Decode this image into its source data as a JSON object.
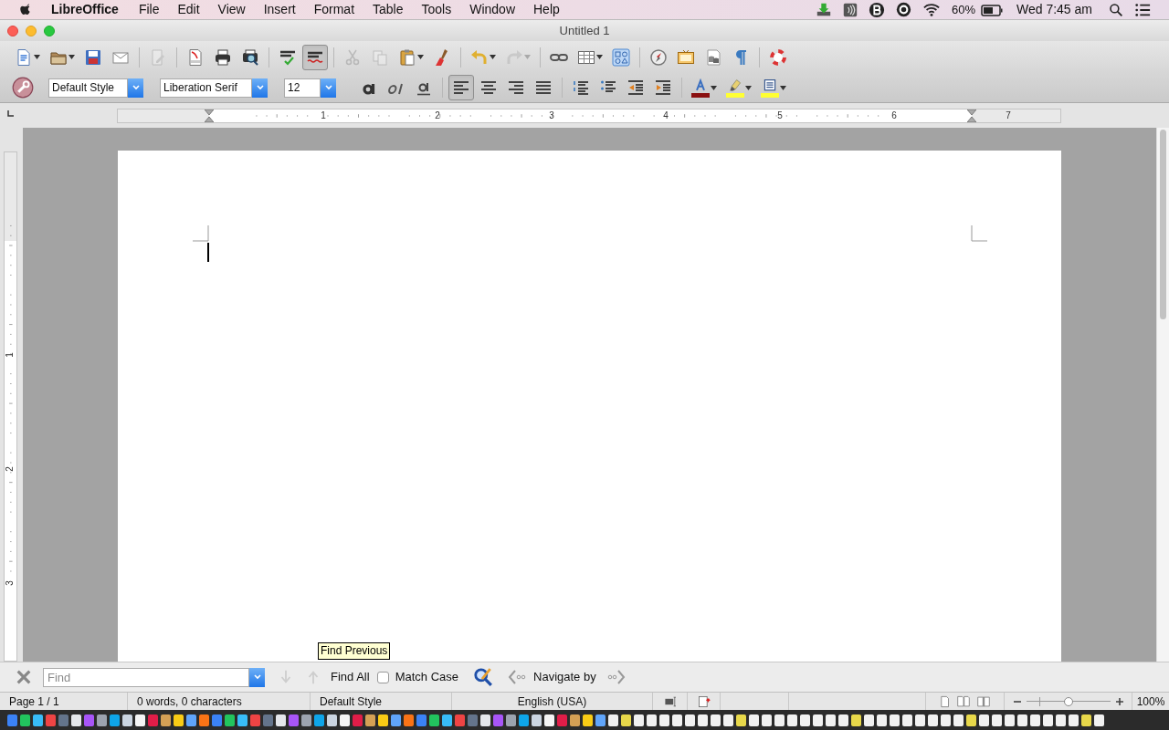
{
  "menu_bar": {
    "app_name": "LibreOffice",
    "menus": [
      "File",
      "Edit",
      "View",
      "Insert",
      "Format",
      "Table",
      "Tools",
      "Window",
      "Help"
    ],
    "battery": "60%",
    "clock": "Wed 7:45 am"
  },
  "window": {
    "title": "Untitled 1"
  },
  "standard_toolbar": [
    {
      "kind": "new",
      "dropdown": true,
      "disabled": false,
      "selected": false
    },
    {
      "kind": "open",
      "dropdown": true,
      "disabled": false,
      "selected": false
    },
    {
      "kind": "save",
      "dropdown": false,
      "disabled": false,
      "selected": false
    },
    {
      "kind": "email",
      "dropdown": false,
      "disabled": false,
      "selected": false
    },
    {
      "kind": "separator"
    },
    {
      "kind": "edit",
      "dropdown": false,
      "disabled": true,
      "selected": false
    },
    {
      "kind": "separator"
    },
    {
      "kind": "pdf",
      "dropdown": false,
      "disabled": false,
      "selected": false
    },
    {
      "kind": "print",
      "dropdown": false,
      "disabled": false,
      "selected": false
    },
    {
      "kind": "preview",
      "dropdown": false,
      "disabled": false,
      "selected": false
    },
    {
      "kind": "separator"
    },
    {
      "kind": "spell",
      "dropdown": false,
      "disabled": false,
      "selected": false
    },
    {
      "kind": "autospell",
      "dropdown": false,
      "disabled": false,
      "selected": true
    },
    {
      "kind": "separator"
    },
    {
      "kind": "cut",
      "dropdown": false,
      "disabled": true,
      "selected": false
    },
    {
      "kind": "copy",
      "dropdown": false,
      "disabled": true,
      "selected": false
    },
    {
      "kind": "paste",
      "dropdown": true,
      "disabled": false,
      "selected": false
    },
    {
      "kind": "clone",
      "dropdown": false,
      "disabled": false,
      "selected": false
    },
    {
      "kind": "separator"
    },
    {
      "kind": "undo",
      "dropdown": true,
      "disabled": false,
      "selected": false
    },
    {
      "kind": "redo",
      "dropdown": true,
      "disabled": true,
      "selected": false
    },
    {
      "kind": "separator"
    },
    {
      "kind": "hyperlink",
      "dropdown": false,
      "disabled": false,
      "selected": false
    },
    {
      "kind": "table",
      "dropdown": true,
      "disabled": false,
      "selected": false
    },
    {
      "kind": "draw",
      "dropdown": false,
      "disabled": false,
      "selected": false
    },
    {
      "kind": "separator"
    },
    {
      "kind": "navigator",
      "dropdown": false,
      "disabled": false,
      "selected": false
    },
    {
      "kind": "gallery",
      "dropdown": false,
      "disabled": false,
      "selected": false
    },
    {
      "kind": "datasource",
      "dropdown": false,
      "disabled": false,
      "selected": false
    },
    {
      "kind": "marks",
      "dropdown": false,
      "disabled": false,
      "selected": false
    },
    {
      "kind": "separator"
    },
    {
      "kind": "help",
      "dropdown": false,
      "disabled": false,
      "selected": false
    }
  ],
  "formatting_toolbar": {
    "paragraph_style": "Default Style",
    "font_name": "Liberation Serif",
    "font_size": "12",
    "buttons": [
      {
        "kind": "bold",
        "dropdown": false,
        "disabled": false,
        "selected": false
      },
      {
        "kind": "italic",
        "dropdown": false,
        "disabled": false,
        "selected": false
      },
      {
        "kind": "underline",
        "dropdown": false,
        "disabled": false,
        "selected": false
      },
      {
        "kind": "separator"
      },
      {
        "kind": "align_left",
        "dropdown": false,
        "disabled": false,
        "selected": true
      },
      {
        "kind": "align_center",
        "dropdown": false,
        "disabled": false,
        "selected": false
      },
      {
        "kind": "align_right",
        "dropdown": false,
        "disabled": false,
        "selected": false
      },
      {
        "kind": "justify",
        "dropdown": false,
        "disabled": false,
        "selected": false
      },
      {
        "kind": "separator"
      },
      {
        "kind": "numbering",
        "dropdown": false,
        "disabled": false,
        "selected": false
      },
      {
        "kind": "bullets",
        "dropdown": false,
        "disabled": false,
        "selected": false
      },
      {
        "kind": "indent_less",
        "dropdown": false,
        "disabled": false,
        "selected": false
      },
      {
        "kind": "indent_more",
        "dropdown": false,
        "disabled": false,
        "selected": false
      },
      {
        "kind": "separator"
      },
      {
        "kind": "font_color",
        "dropdown": true,
        "disabled": false,
        "selected": false,
        "color": "#8b1010"
      },
      {
        "kind": "highlight",
        "dropdown": true,
        "disabled": false,
        "selected": false,
        "color": "#ffff33"
      },
      {
        "kind": "background",
        "dropdown": true,
        "disabled": false,
        "selected": false,
        "color": "#ffff33"
      }
    ]
  },
  "horizontal_ruler": {
    "numbers": [
      "1",
      "2",
      "3",
      "4",
      "5",
      "6",
      "7"
    ]
  },
  "vertical_ruler": {
    "numbers": [
      "1",
      "2",
      "3"
    ]
  },
  "tooltip": "Find Previous",
  "find_bar": {
    "placeholder": "Find",
    "find_next": {
      "disabled": true
    },
    "find_previous": {
      "disabled": true
    },
    "find_all": "Find All",
    "match_case": {
      "label": "Match Case",
      "checked": false
    },
    "navigate_by": "Navigate by"
  },
  "status_bar": {
    "page": "Page 1 / 1",
    "word_count": "0 words, 0 characters",
    "page_style": "Default Style",
    "language": "English (USA)",
    "zoom": {
      "level": 0.5,
      "reading": "100%"
    }
  }
}
